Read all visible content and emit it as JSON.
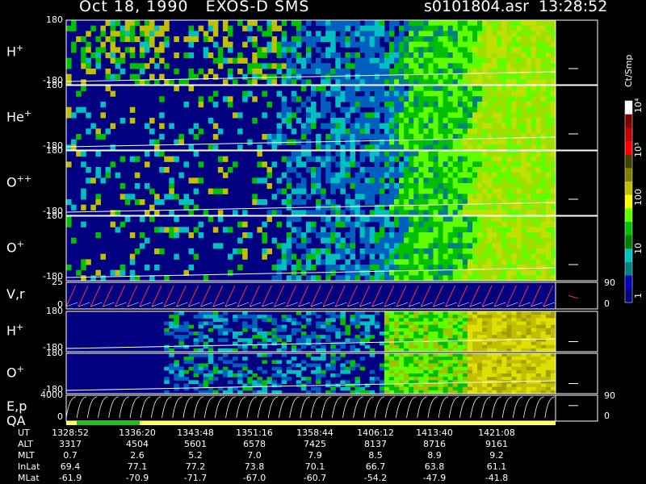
{
  "header": {
    "title": "Oct 18, 1990   EXOS-D SMS",
    "file_time": "s0101804.asr  13:28:52"
  },
  "panels": [
    {
      "id": "h1",
      "label": "H",
      "sup": "+",
      "top_tick": "180",
      "bottom_tick": "-180"
    },
    {
      "id": "he",
      "label": "He",
      "sup": "+",
      "top_tick": "180",
      "bottom_tick": "-180"
    },
    {
      "id": "opp",
      "label": "O",
      "sup": "++",
      "top_tick": "180",
      "bottom_tick": "-180"
    },
    {
      "id": "o1",
      "label": "O",
      "sup": "+",
      "top_tick": "180",
      "bottom_tick": "-180"
    },
    {
      "id": "vr",
      "label": "V,r",
      "sup": "",
      "top_tick": "25",
      "bottom_tick": "0",
      "right_top": "90",
      "right_bottom": "0"
    },
    {
      "id": "h2",
      "label": "H",
      "sup": "+",
      "top_tick": "180",
      "bottom_tick": "-180"
    },
    {
      "id": "o2",
      "label": "O",
      "sup": "+",
      "top_tick": "180",
      "bottom_tick": "-180"
    },
    {
      "id": "ep",
      "label": "E,p",
      "sup": "",
      "top_tick": "4000",
      "bottom_tick": "0",
      "right_top": "90",
      "right_bottom": "0"
    }
  ],
  "qa_label": "QA",
  "colorbar": {
    "units": "Ct/Smp",
    "labels": [
      "10⁴",
      "10³",
      "100",
      "10",
      "1"
    ],
    "colors": [
      "#ffffff",
      "#800000",
      "#c00000",
      "#ff0000",
      "#404000",
      "#808000",
      "#c0c000",
      "#ffff00",
      "#60ff00",
      "#00c000",
      "#008000",
      "#00c0c0",
      "#008080",
      "#0000c0",
      "#000080"
    ]
  },
  "ephemeris": {
    "rows": [
      {
        "name": "UT",
        "values": [
          "1328:52",
          "1336:20",
          "1343:48",
          "1351:16",
          "1358:44",
          "1406:12",
          "1413:40",
          "1421:08"
        ]
      },
      {
        "name": "ALT",
        "values": [
          "3317",
          "4504",
          "5601",
          "6578",
          "7425",
          "8137",
          "8716",
          "9161"
        ]
      },
      {
        "name": "MLT",
        "values": [
          "0.7",
          "2.6",
          "5.2",
          "7.0",
          "7.9",
          "8.5",
          "8.9",
          "9.2"
        ]
      },
      {
        "name": "InLat",
        "values": [
          "69.4",
          "77.1",
          "77.2",
          "73.8",
          "70.1",
          "66.7",
          "63.8",
          "61.1"
        ]
      },
      {
        "name": "MLat",
        "values": [
          "-61.9",
          "-70.9",
          "-71.7",
          "-67.0",
          "-60.7",
          "-54.2",
          "-47.9",
          "-41.8"
        ]
      }
    ]
  },
  "side_id": "Sep-00  2CA33L",
  "chart_data": {
    "type": "heatmap",
    "title": "Oct 18, 1990   EXOS-D SMS",
    "xlabel": "UT",
    "x_ticks": [
      "1328:52",
      "1336:20",
      "1343:48",
      "1351:16",
      "1358:44",
      "1406:12",
      "1413:40",
      "1421:08"
    ],
    "series": [
      {
        "name": "H+",
        "ylim": [
          -180,
          180
        ]
      },
      {
        "name": "He+",
        "ylim": [
          -180,
          180
        ]
      },
      {
        "name": "O++",
        "ylim": [
          -180,
          180
        ]
      },
      {
        "name": "O+",
        "ylim": [
          -180,
          180
        ]
      },
      {
        "name": "V,r",
        "ylim": [
          0,
          25
        ]
      },
      {
        "name": "H+",
        "ylim": [
          -180,
          180
        ]
      },
      {
        "name": "O+",
        "ylim": [
          -180,
          180
        ]
      },
      {
        "name": "E,p",
        "ylim": [
          0,
          4000
        ]
      }
    ],
    "colorbar_unit": "Ct/Smp",
    "colorbar_range": [
      "1",
      "10⁴"
    ]
  }
}
